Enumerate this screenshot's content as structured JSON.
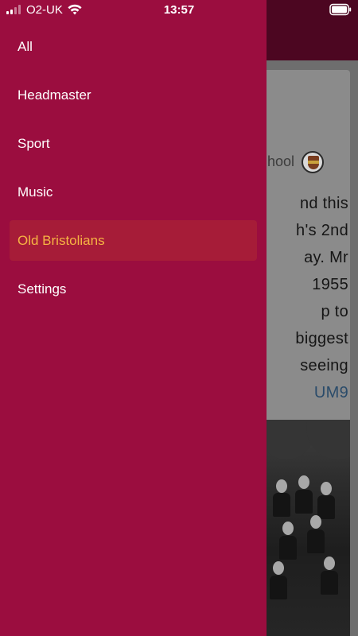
{
  "status_bar": {
    "carrier": "O2-UK",
    "time": "13:57",
    "signal_icon": "signal-bars-icon",
    "wifi_icon": "wifi-icon",
    "battery_icon": "battery-icon"
  },
  "drawer": {
    "items": [
      {
        "label": "All"
      },
      {
        "label": "Headmaster"
      },
      {
        "label": "Sport"
      },
      {
        "label": "Music"
      },
      {
        "label": "Old Bristolians"
      },
      {
        "label": "Settings"
      }
    ],
    "active_item": "Old Bristolians",
    "colors": {
      "background": "#9b0d3f",
      "active_background": "#a61c38",
      "active_text": "#f6b443",
      "text": "#ffffff"
    }
  },
  "background_feed": {
    "card": {
      "source_partial": "hool",
      "text_lines": [
        "nd this",
        "h's 2nd",
        "ay. Mr",
        "1955",
        "p to",
        "biggest",
        "seeing"
      ],
      "link_partial": "UM9"
    }
  }
}
